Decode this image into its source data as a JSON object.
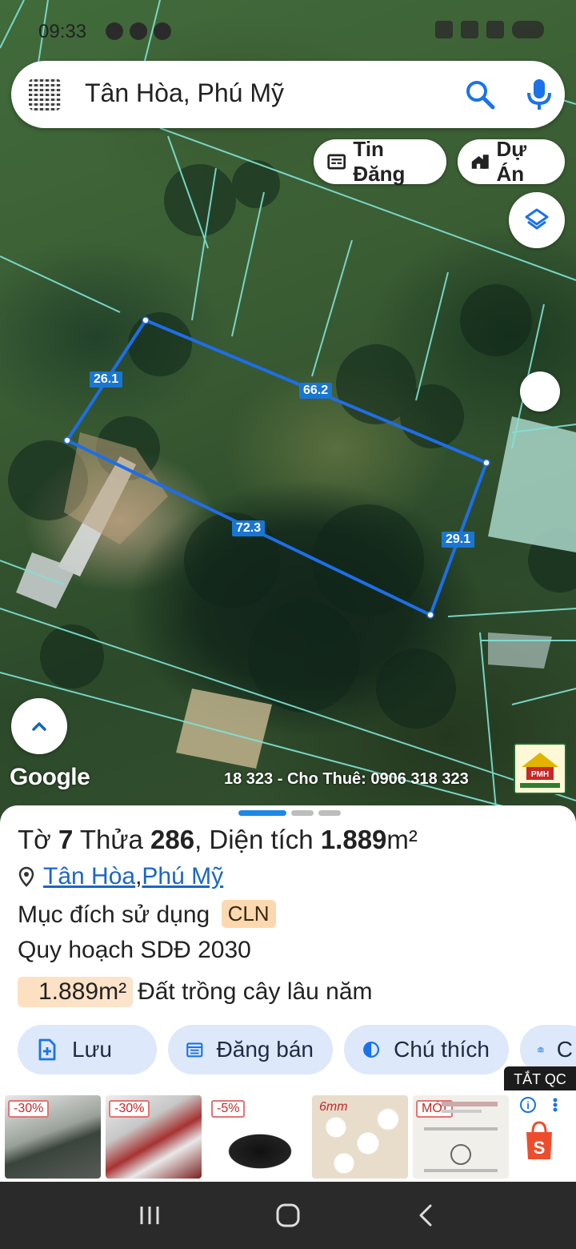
{
  "status": {
    "time": "09:33"
  },
  "search": {
    "query": "Tân Hòa, Phú Mỹ"
  },
  "chips": {
    "tin_dang": "Tin Đăng",
    "du_an": "Dự Án"
  },
  "parcel": {
    "edge_top": "26.1",
    "edge_long_top": "66.2",
    "edge_long_bottom": "72.3",
    "edge_right": "29.1"
  },
  "map": {
    "provider": "Google",
    "watermark": "18 323 - Cho Thuê: 0906 318 323"
  },
  "sheet": {
    "to_label": "Tờ ",
    "to_value": "7",
    "thua_label": " Thửa ",
    "thua_value": "286",
    "dientich_label": ", Diện tích ",
    "dientich_value": "1.889",
    "dientich_unit": "m²",
    "location_1": "Tân Hòa",
    "location_sep": ", ",
    "location_2": "Phú Mỹ",
    "purpose_label": "Mục đích sử dụng",
    "purpose_code": "CLN",
    "plan_label": "Quy hoạch SDĐ 2030",
    "plan_area": "1.889m²",
    "plan_type": "Đất trồng cây lâu năm"
  },
  "actions": {
    "save": "Lưu",
    "post_sale": "Đăng bán",
    "legend": "Chú thích",
    "photo": "C"
  },
  "ads": {
    "close_label": "TẮT QC",
    "tags": [
      "-30%",
      "-30%",
      "-5%",
      "6mm",
      "MỚI"
    ]
  },
  "colors": {
    "parcel_line": "#1e6ee8",
    "boundary": "#7fe3d6",
    "accent": "#1a73e8",
    "action_bg": "#dde8fa"
  }
}
